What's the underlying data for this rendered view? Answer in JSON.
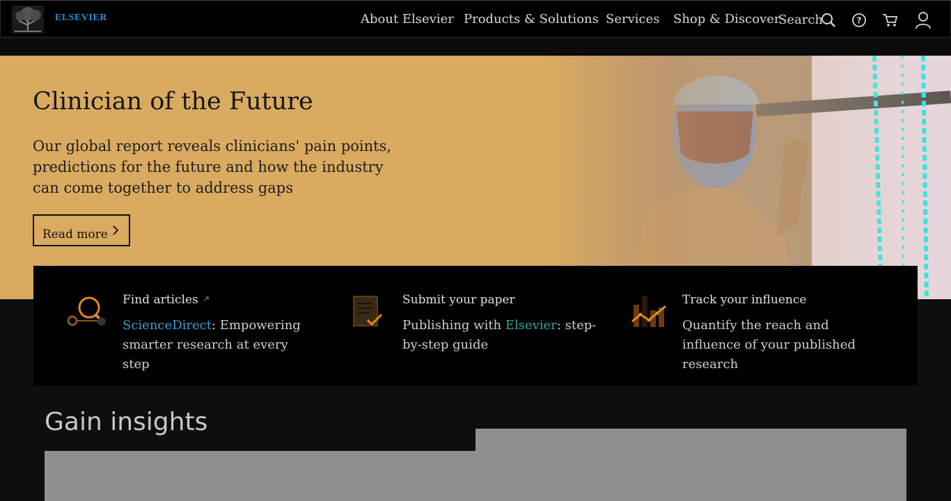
{
  "header": {
    "brand": "ELSEVIER",
    "nav": [
      "About Elsevier",
      "Products & Solutions",
      "Services",
      "Shop & Discover"
    ],
    "search_label": "Search",
    "icons": [
      "search-icon",
      "help-icon",
      "cart-icon",
      "user-icon"
    ]
  },
  "hero": {
    "title": "Clinician of the Future",
    "description": "Our global report reveals clinicians' pain points, predictions for the future and how the industry can come together to address gaps",
    "button": "Read more"
  },
  "cards": [
    {
      "title": "Find articles",
      "link": "ScienceDirect",
      "desc_rest": ": Empowering smarter research at every step",
      "icon": "magnifier-icon"
    },
    {
      "title": "Submit your paper",
      "desc_pre": "Publishing with ",
      "link": "Elsevier",
      "desc_rest": ": step-by-step guide",
      "icon": "document-check-icon"
    },
    {
      "title": "Track your influence",
      "desc": "Quantify the reach and influence of your published research",
      "icon": "chart-icon"
    }
  ],
  "section": {
    "title": "Gain insights"
  },
  "colors": {
    "hero_bg": "#d9aa5f",
    "accent_orange": "#e08a24",
    "link_blue": "#3aa0cf",
    "link_teal": "#30a79d"
  }
}
